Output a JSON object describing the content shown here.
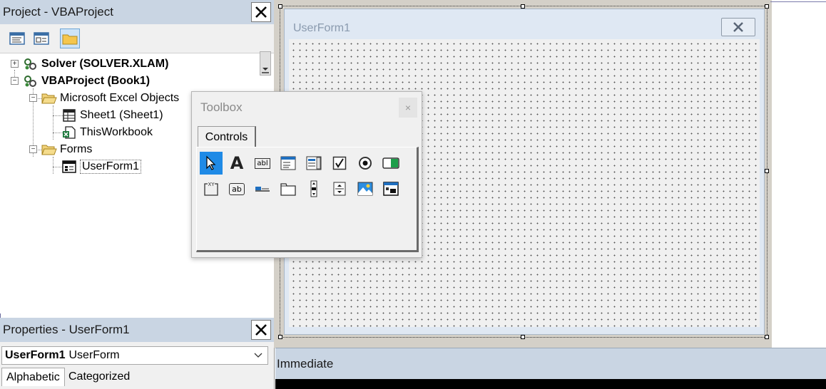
{
  "project": {
    "title": "Project - VBAProject",
    "close_icon": "close-x-icon",
    "toolbar": {
      "view_code_icon": "view-code-icon",
      "view_object_icon": "view-object-icon",
      "toggle_folders_icon": "folder-icon"
    },
    "tree": [
      {
        "label": "Solver (SOLVER.XLAM)",
        "bold": true,
        "icon": "vba-project-icon",
        "expander": "+"
      },
      {
        "label": "VBAProject (Book1)",
        "bold": true,
        "icon": "vba-project-icon",
        "expander": "−"
      },
      {
        "label": "Microsoft Excel Objects",
        "icon": "folder-open-icon",
        "expander": "−"
      },
      {
        "label": "Sheet1 (Sheet1)",
        "icon": "worksheet-icon"
      },
      {
        "label": "ThisWorkbook",
        "icon": "workbook-icon"
      },
      {
        "label": "Forms",
        "icon": "folder-open-icon",
        "expander": "−"
      },
      {
        "label": "UserForm1",
        "icon": "userform-icon",
        "selected": true
      }
    ]
  },
  "properties": {
    "title": "Properties - UserForm1",
    "object_name": "UserForm1",
    "object_type": "UserForm",
    "tabs": [
      {
        "label": "Alphabetic",
        "active": true
      },
      {
        "label": "Categorized",
        "active": false
      }
    ]
  },
  "userform": {
    "title": "UserForm1",
    "close_icon": "close-x-icon"
  },
  "toolbox": {
    "title": "Toolbox",
    "close_glyph": "×",
    "tab_label": "Controls",
    "tools_row1": [
      "select-objects-icon",
      "label-icon",
      "textbox-icon",
      "combobox-icon",
      "listbox-icon",
      "checkbox-icon",
      "optionbutton-icon",
      "togglebutton-icon"
    ],
    "tools_row2": [
      "frame-icon",
      "commandbutton-icon",
      "tabstrip-icon",
      "multipage-icon",
      "scrollbar-icon",
      "spinbutton-icon",
      "image-icon",
      "refedit-icon"
    ],
    "label_glyph": "A",
    "frame_glyph": "xy",
    "commandbutton_glyph": "ab",
    "textbox_glyph": "abl"
  },
  "immediate": {
    "title": "Immediate"
  },
  "colors": {
    "pane_title_bg": "#c9d5e3",
    "selected_tool_bg": "#1f8ae6",
    "form_bg": "#dfe8f3"
  }
}
